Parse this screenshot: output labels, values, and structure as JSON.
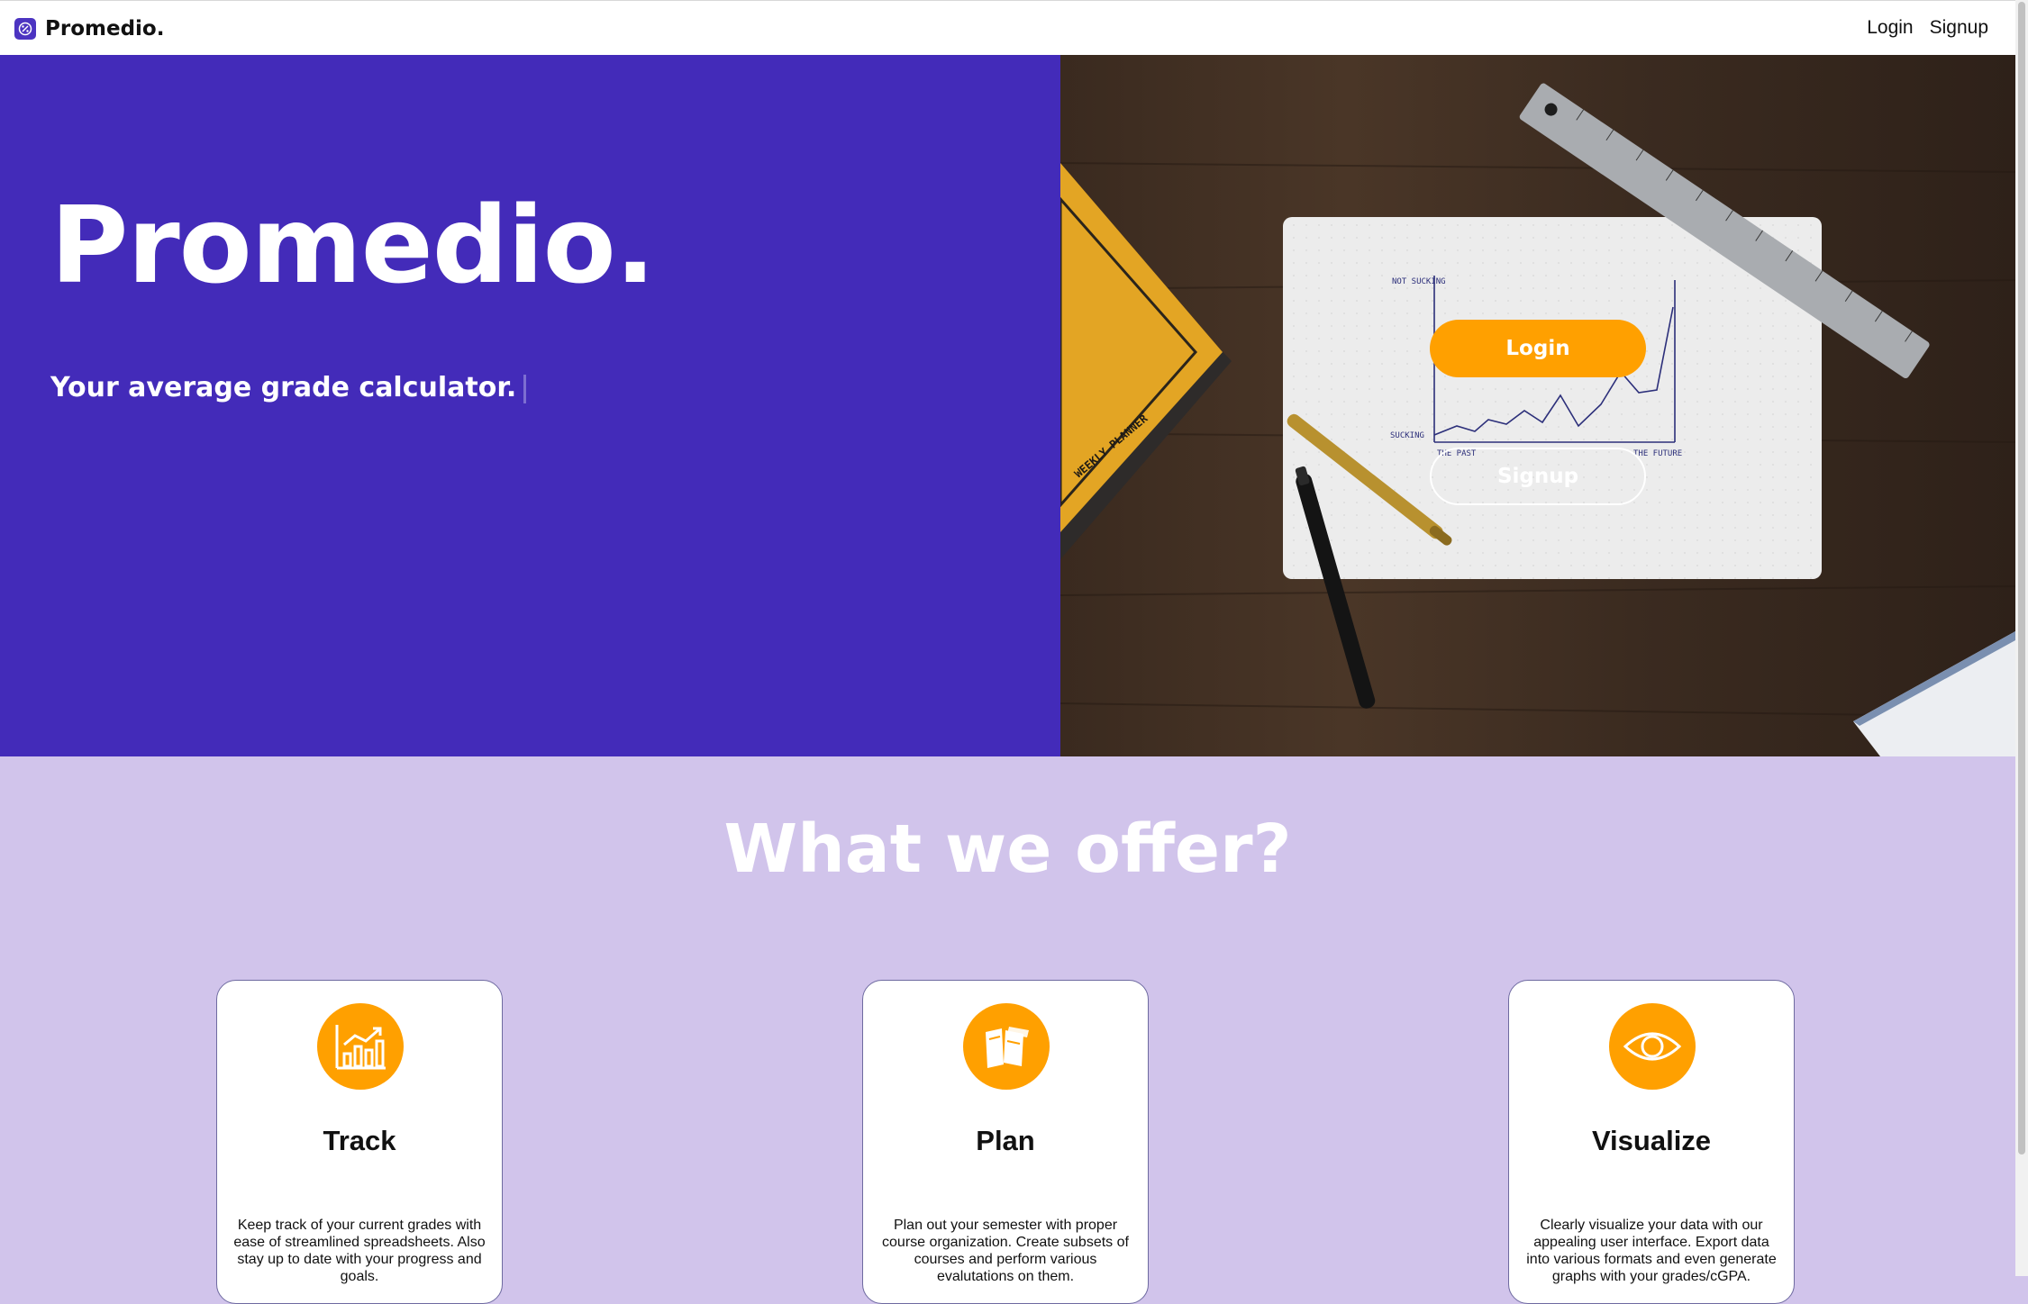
{
  "nav": {
    "brand": "Promedio.",
    "login": "Login",
    "signup": "Signup"
  },
  "hero": {
    "title": "Promedio.",
    "tagline": "Your average grade calculator.",
    "login_button": "Login",
    "signup_button": "Signup",
    "image_labels": {
      "not_sucking": "NOT SUCKING",
      "sucking": "SUCKING",
      "the_past": "THE PAST",
      "the_future": "THE FUTURE",
      "planner": "WEEKLY PLANNER"
    }
  },
  "offer": {
    "title": "What we offer?",
    "cards": [
      {
        "title": "Track",
        "icon": "bar-chart-icon",
        "text": "Keep track of your current grades with ease of streamlined spreadsheets. Also stay up to date with your progress and goals."
      },
      {
        "title": "Plan",
        "icon": "books-icon",
        "text": "Plan out your semester with proper course organization. Create subsets of courses and perform various evalutations on them."
      },
      {
        "title": "Visualize",
        "icon": "eye-icon",
        "text": "Clearly visualize your data with our appealing user interface. Export data into various formats and even generate graphs with your grades/cGPA."
      }
    ]
  },
  "colors": {
    "brand_purple": "#432bb9",
    "accent_orange": "#ffa000",
    "section_bg": "#d1c4eb"
  }
}
